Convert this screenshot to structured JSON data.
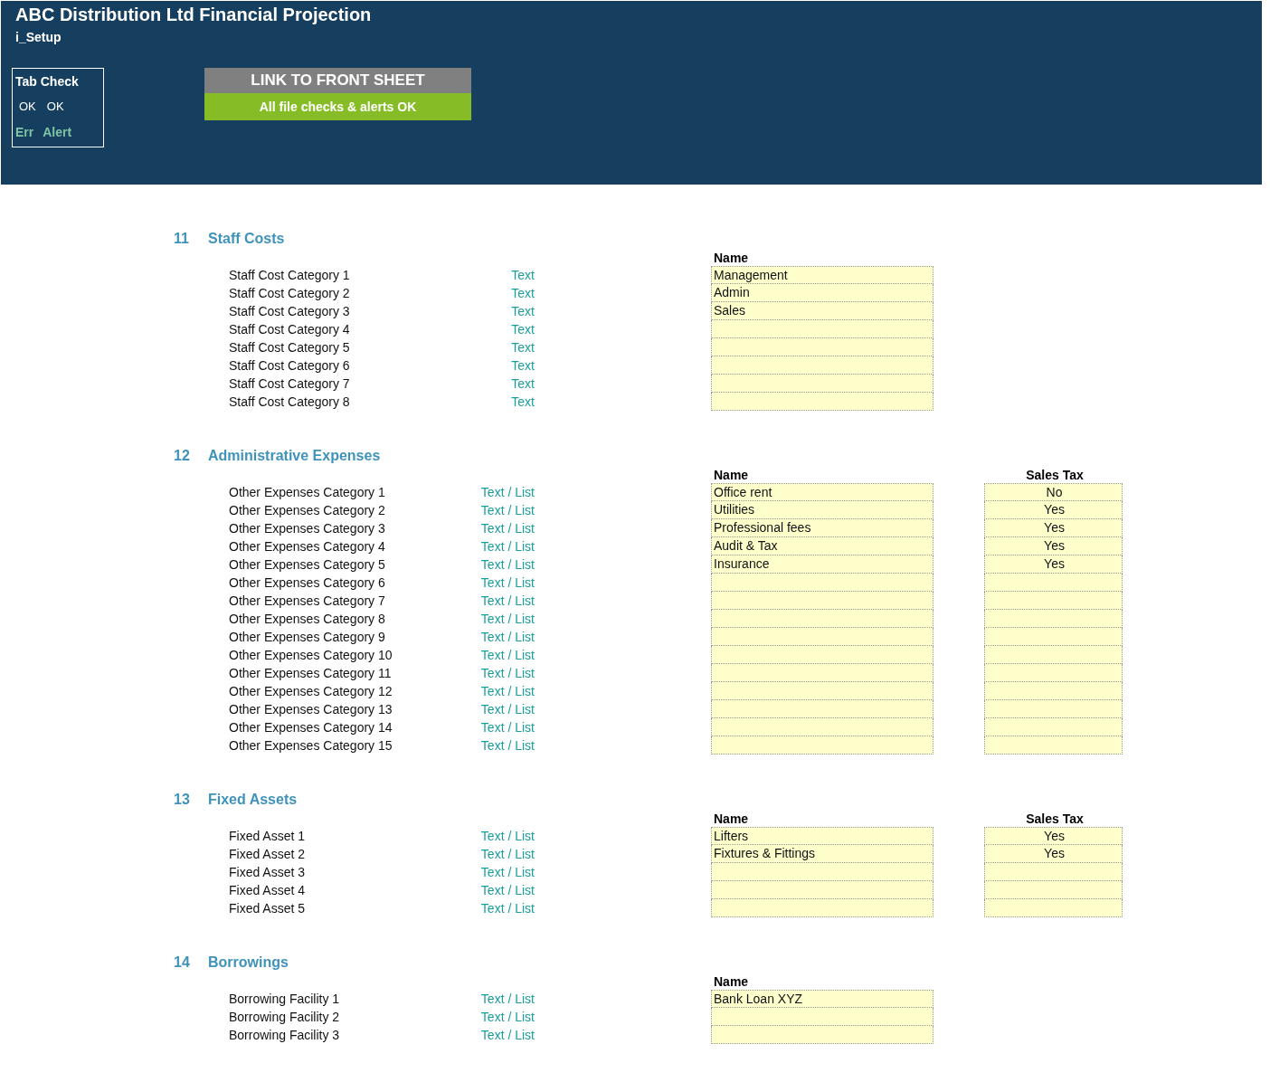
{
  "header": {
    "title": "ABC Distribution Ltd Financial Projection",
    "sheet": "i_Setup",
    "tab_check": {
      "title": "Tab Check",
      "statuses": [
        "OK",
        "OK"
      ],
      "flags": [
        "Err",
        "Alert"
      ]
    },
    "link_button": "LINK TO FRONT SHEET",
    "check_status": "All file checks & alerts OK"
  },
  "sections": [
    {
      "number": "11",
      "title": "Staff Costs",
      "columns": [
        "Name"
      ],
      "rows": [
        {
          "label": "Staff Cost Category 1",
          "type": "Text",
          "values": [
            "Management"
          ]
        },
        {
          "label": "Staff Cost Category 2",
          "type": "Text",
          "values": [
            "Admin"
          ]
        },
        {
          "label": "Staff Cost Category 3",
          "type": "Text",
          "values": [
            "Sales"
          ]
        },
        {
          "label": "Staff Cost Category 4",
          "type": "Text",
          "values": []
        },
        {
          "label": "Staff Cost Category 5",
          "type": "Text",
          "values": []
        },
        {
          "label": "Staff Cost Category 6",
          "type": "Text",
          "values": []
        },
        {
          "label": "Staff Cost Category 7",
          "type": "Text",
          "values": []
        },
        {
          "label": "Staff Cost Category 8",
          "type": "Text",
          "values": []
        }
      ]
    },
    {
      "number": "12",
      "title": "Administrative Expenses",
      "columns": [
        "Name",
        "Sales Tax"
      ],
      "rows": [
        {
          "label": "Other Expenses Category 1",
          "type": "Text / List",
          "values": [
            "Office rent",
            "No"
          ]
        },
        {
          "label": "Other Expenses Category 2",
          "type": "Text / List",
          "values": [
            "Utilities",
            "Yes"
          ]
        },
        {
          "label": "Other Expenses Category 3",
          "type": "Text / List",
          "values": [
            "Professional fees",
            "Yes"
          ]
        },
        {
          "label": "Other Expenses Category 4",
          "type": "Text / List",
          "values": [
            "Audit & Tax",
            "Yes"
          ]
        },
        {
          "label": "Other Expenses Category 5",
          "type": "Text / List",
          "values": [
            "Insurance",
            "Yes"
          ]
        },
        {
          "label": "Other Expenses Category 6",
          "type": "Text / List",
          "values": []
        },
        {
          "label": "Other Expenses Category 7",
          "type": "Text / List",
          "values": []
        },
        {
          "label": "Other Expenses Category 8",
          "type": "Text / List",
          "values": []
        },
        {
          "label": "Other Expenses Category 9",
          "type": "Text / List",
          "values": []
        },
        {
          "label": "Other Expenses Category 10",
          "type": "Text / List",
          "values": []
        },
        {
          "label": "Other Expenses Category 11",
          "type": "Text / List",
          "values": []
        },
        {
          "label": "Other Expenses Category 12",
          "type": "Text / List",
          "values": []
        },
        {
          "label": "Other Expenses Category 13",
          "type": "Text / List",
          "values": []
        },
        {
          "label": "Other Expenses Category 14",
          "type": "Text / List",
          "values": []
        },
        {
          "label": "Other Expenses Category 15",
          "type": "Text / List",
          "values": []
        }
      ]
    },
    {
      "number": "13",
      "title": "Fixed Assets",
      "columns": [
        "Name",
        "Sales Tax"
      ],
      "rows": [
        {
          "label": "Fixed Asset 1",
          "type": "Text / List",
          "values": [
            "Lifters",
            "Yes"
          ]
        },
        {
          "label": "Fixed Asset 2",
          "type": "Text / List",
          "values": [
            "Fixtures & Fittings",
            "Yes"
          ]
        },
        {
          "label": "Fixed Asset 3",
          "type": "Text / List",
          "values": []
        },
        {
          "label": "Fixed Asset 4",
          "type": "Text / List",
          "values": []
        },
        {
          "label": "Fixed Asset 5",
          "type": "Text / List",
          "values": []
        }
      ]
    },
    {
      "number": "14",
      "title": "Borrowings",
      "columns": [
        "Name"
      ],
      "rows": [
        {
          "label": "Borrowing Facility 1",
          "type": "Text / List",
          "values": [
            "Bank Loan XYZ"
          ]
        },
        {
          "label": "Borrowing Facility 2",
          "type": "Text / List",
          "values": []
        },
        {
          "label": "Borrowing Facility 3",
          "type": "Text / List",
          "values": []
        }
      ]
    }
  ]
}
